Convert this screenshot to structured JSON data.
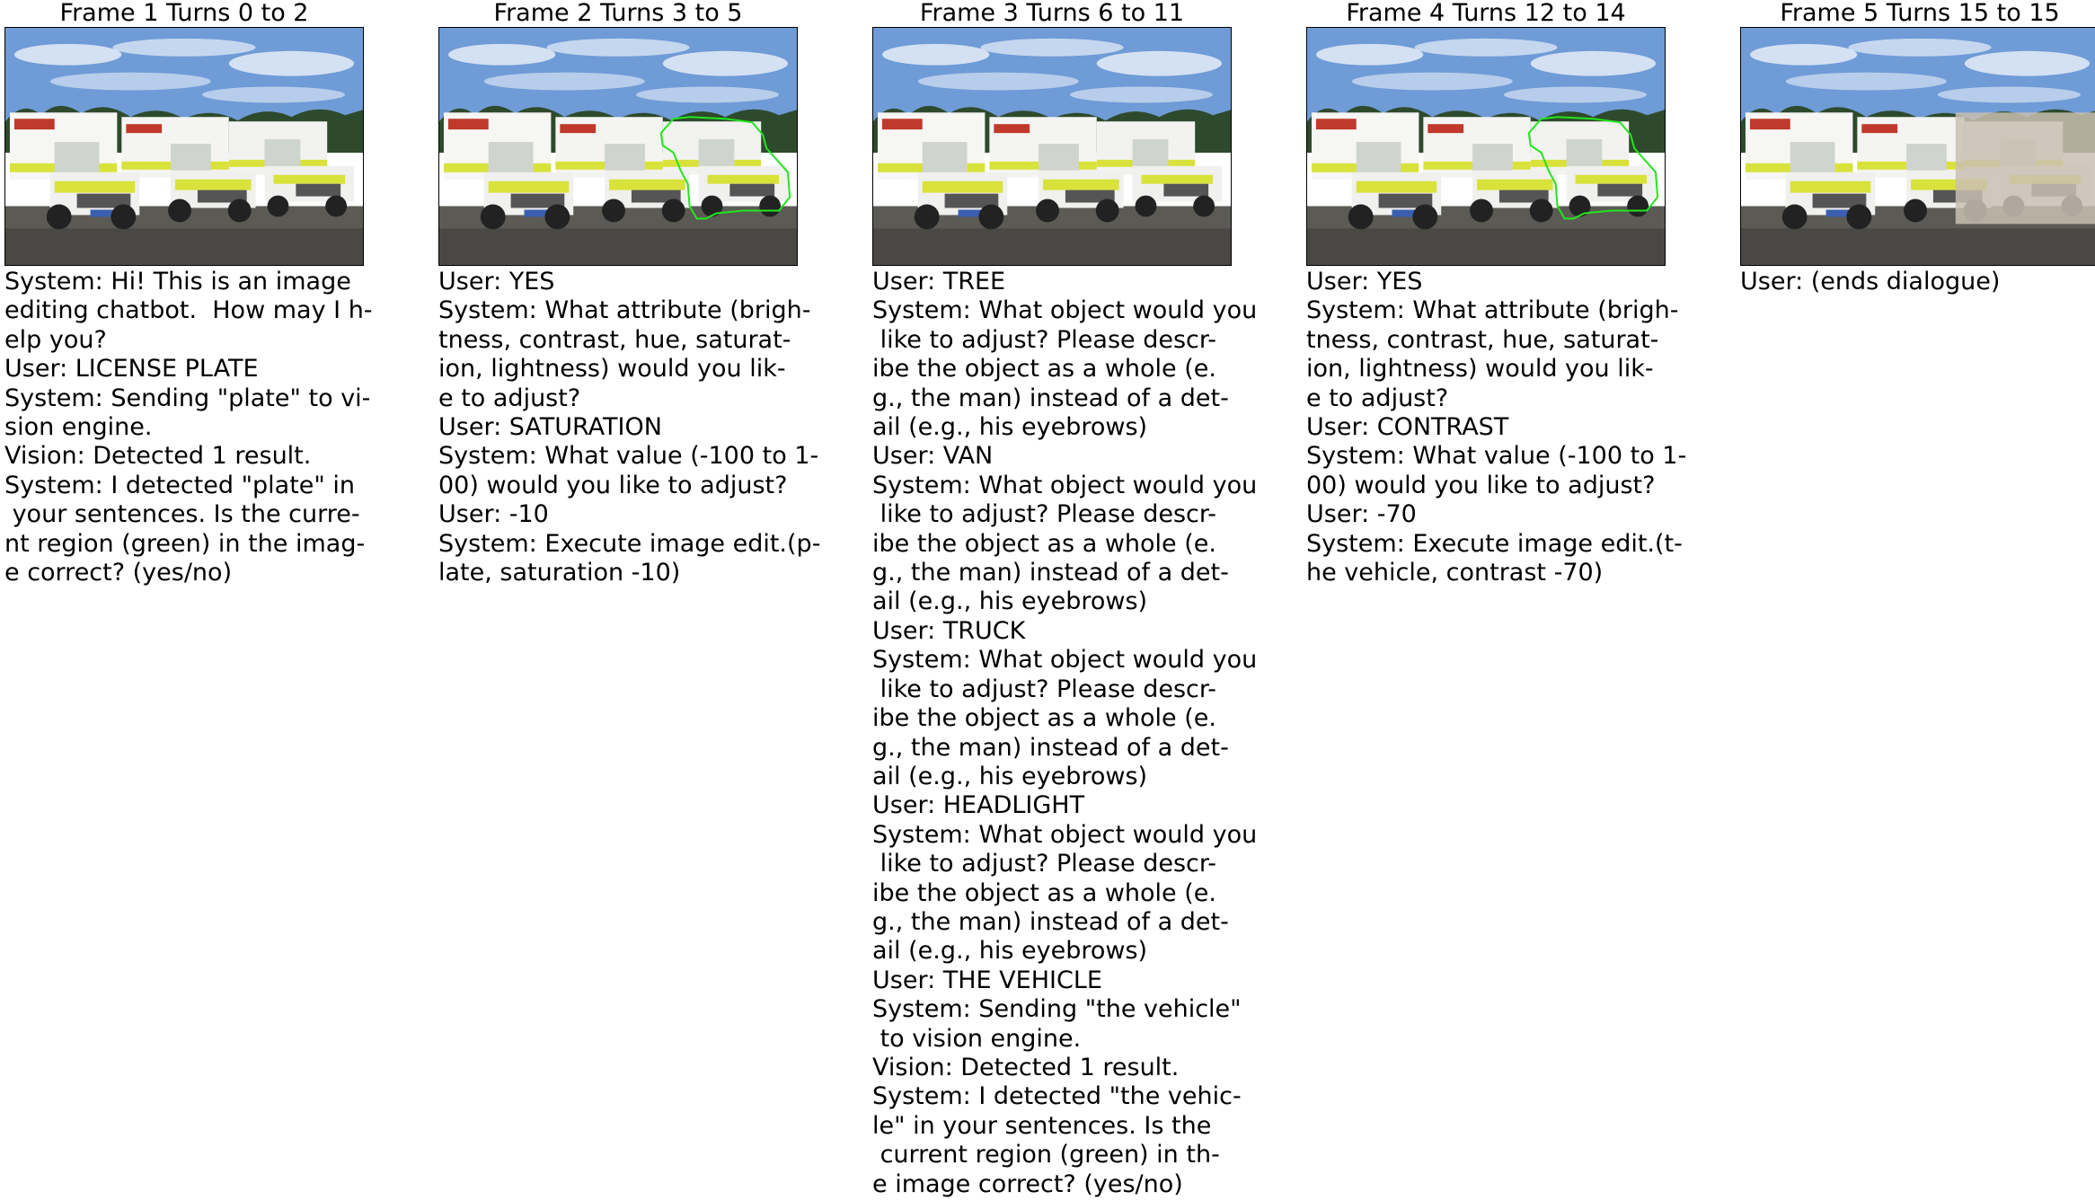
{
  "frames": [
    {
      "title": "Frame 1 Turns 0 to 2",
      "overlay": "none",
      "lines": [
        "System: Hi! This is an image",
        "editing chatbot.  How may I h-",
        "elp you?",
        "User: LICENSE PLATE",
        "System: Sending \"plate\" to vi-",
        "sion engine.",
        "Vision: Detected 1 result.",
        "System: I detected \"plate\" in",
        " your sentences. Is the curre-",
        "nt region (green) in the imag-",
        "e correct? (yes/no)"
      ]
    },
    {
      "title": "Frame 2 Turns 3 to 5",
      "overlay": "outline",
      "lines": [
        "User: YES",
        "System: What attribute (brigh-",
        "tness, contrast, hue, saturat-",
        "ion, lightness) would you lik-",
        "e to adjust?",
        "User: SATURATION",
        "System: What value (-100 to 1-",
        "00) would you like to adjust?",
        "User: -10",
        "System: Execute image edit.(p-",
        "late, saturation -10)"
      ]
    },
    {
      "title": "Frame 3 Turns 6 to 11",
      "overlay": "none",
      "lines": [
        "User: TREE",
        "System: What object would you",
        " like to adjust? Please descr-",
        "ibe the object as a whole (e.",
        "g., the man) instead of a det-",
        "ail (e.g., his eyebrows)",
        "User: VAN",
        "System: What object would you",
        " like to adjust? Please descr-",
        "ibe the object as a whole (e.",
        "g., the man) instead of a det-",
        "ail (e.g., his eyebrows)",
        "User: TRUCK",
        "System: What object would you",
        " like to adjust? Please descr-",
        "ibe the object as a whole (e.",
        "g., the man) instead of a det-",
        "ail (e.g., his eyebrows)",
        "User: HEADLIGHT",
        "System: What object would you",
        " like to adjust? Please descr-",
        "ibe the object as a whole (e.",
        "g., the man) instead of a det-",
        "ail (e.g., his eyebrows)",
        "User: THE VEHICLE",
        "System: Sending \"the vehicle\"",
        " to vision engine.",
        "Vision: Detected 1 result.",
        "System: I detected \"the vehic-",
        "le\" in your sentences. Is the",
        " current region (green) in th-",
        "e image correct? (yes/no)"
      ]
    },
    {
      "title": "Frame 4 Turns 12 to 14",
      "overlay": "outline",
      "lines": [
        "User: YES",
        "System: What attribute (brigh-",
        "tness, contrast, hue, saturat-",
        "ion, lightness) would you lik-",
        "e to adjust?",
        "User: CONTRAST",
        "System: What value (-100 to 1-",
        "00) would you like to adjust?",
        "User: -70",
        "System: Execute image edit.(t-",
        "he vehicle, contrast -70)"
      ]
    },
    {
      "title": "Frame 5 Turns 15 to 15",
      "overlay": "faded",
      "lines": [
        "User: (ends dialogue)"
      ]
    }
  ],
  "colors": {
    "outline": "#22e61e",
    "sky": "#6f9bd6",
    "ground": "#5b5a55",
    "ambulance": "#f2f2f0",
    "stripe": "#d9e23a"
  }
}
